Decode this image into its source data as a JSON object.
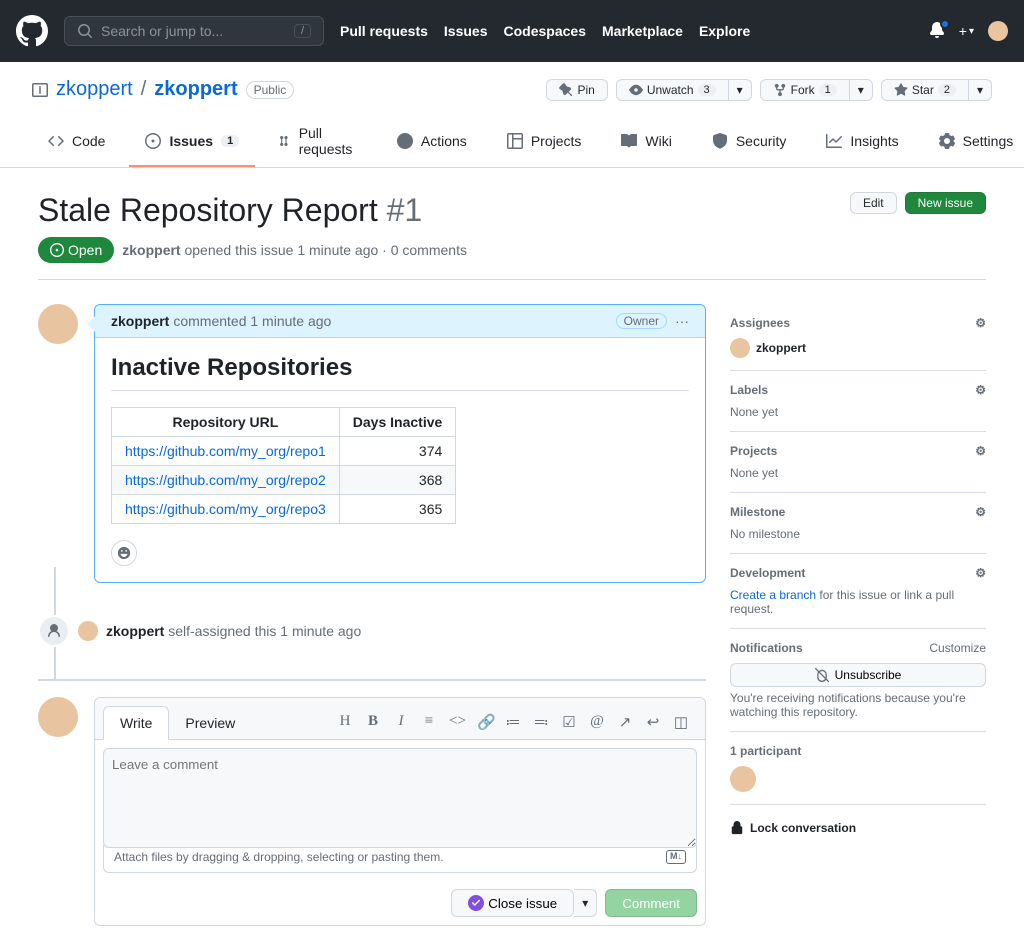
{
  "topnav": {
    "search_placeholder": "Search or jump to...",
    "items": [
      "Pull requests",
      "Issues",
      "Codespaces",
      "Marketplace",
      "Explore"
    ]
  },
  "repo": {
    "owner": "zkoppert",
    "name": "zkoppert",
    "visibility": "Public",
    "actions": {
      "pin": "Pin",
      "unwatch": "Unwatch",
      "unwatch_count": "3",
      "fork": "Fork",
      "fork_count": "1",
      "star": "Star",
      "star_count": "2"
    }
  },
  "tabs": {
    "code": "Code",
    "issues": "Issues",
    "issues_count": "1",
    "pulls": "Pull requests",
    "actions": "Actions",
    "projects": "Projects",
    "wiki": "Wiki",
    "security": "Security",
    "insights": "Insights",
    "settings": "Settings"
  },
  "issue": {
    "title": "Stale Repository Report",
    "number": "#1",
    "edit": "Edit",
    "new_issue": "New issue",
    "state": "Open",
    "author": "zkoppert",
    "meta_text": " opened this issue 1 minute ago · 0 comments"
  },
  "comment": {
    "author": "zkoppert",
    "meta": " commented 1 minute ago",
    "owner_badge": "Owner",
    "heading": "Inactive Repositories",
    "col1": "Repository URL",
    "col2": "Days Inactive",
    "rows": [
      {
        "url": "https://github.com/my_org/repo1",
        "days": "374"
      },
      {
        "url": "https://github.com/my_org/repo2",
        "days": "368"
      },
      {
        "url": "https://github.com/my_org/repo3",
        "days": "365"
      }
    ]
  },
  "event": {
    "actor": "zkoppert",
    "text": " self-assigned this 1 minute ago"
  },
  "composer": {
    "write": "Write",
    "preview": "Preview",
    "placeholder": "Leave a comment",
    "attach": "Attach files by dragging & dropping, selecting or pasting them.",
    "close_issue": "Close issue",
    "comment": "Comment"
  },
  "sidebar": {
    "assignees": {
      "label": "Assignees",
      "user": "zkoppert"
    },
    "labels": {
      "label": "Labels",
      "value": "None yet"
    },
    "projects": {
      "label": "Projects",
      "value": "None yet"
    },
    "milestone": {
      "label": "Milestone",
      "value": "No milestone"
    },
    "development": {
      "label": "Development",
      "link": "Create a branch",
      "rest": " for this issue or link a pull request."
    },
    "notifications": {
      "label": "Notifications",
      "customize": "Customize",
      "button": "Unsubscribe",
      "text": "You're receiving notifications because you're watching this repository."
    },
    "participants": {
      "label": "1 participant"
    },
    "lock": "Lock conversation"
  }
}
